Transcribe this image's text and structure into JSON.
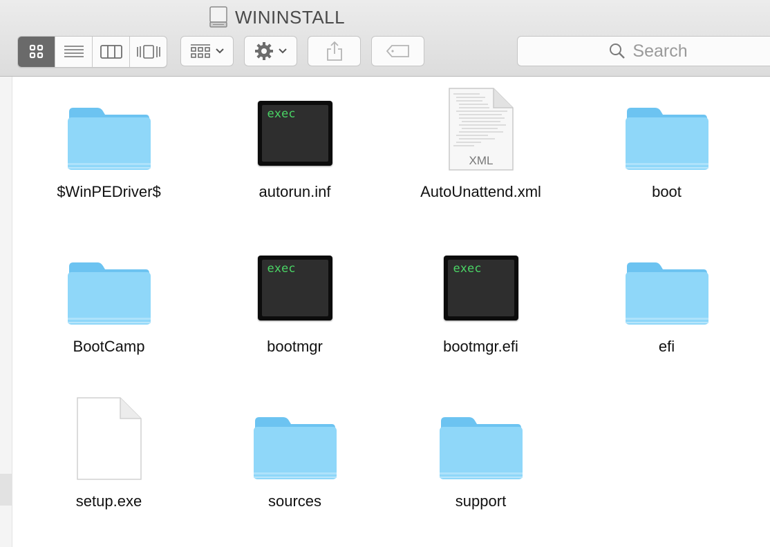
{
  "window": {
    "title": "WININSTALL"
  },
  "toolbar": {
    "view_modes": [
      {
        "name": "icon-view",
        "active": true
      },
      {
        "name": "list-view",
        "active": false
      },
      {
        "name": "column-view",
        "active": false
      },
      {
        "name": "cover-flow-view",
        "active": false
      }
    ],
    "arrange_icon": "grid-arrange-icon",
    "action_icon": "gear-icon",
    "share_icon": "share-icon",
    "tags_icon": "tag-icon",
    "search": {
      "placeholder": "Search"
    }
  },
  "files": [
    {
      "name": "$WinPEDriver$",
      "kind": "folder"
    },
    {
      "name": "autorun.inf",
      "kind": "exec",
      "badge": "exec"
    },
    {
      "name": "AutoUnattend.xml",
      "kind": "xml",
      "badge": "XML"
    },
    {
      "name": "boot",
      "kind": "folder"
    },
    {
      "name": "BootCamp",
      "kind": "folder"
    },
    {
      "name": "bootmgr",
      "kind": "exec",
      "badge": "exec"
    },
    {
      "name": "bootmgr.efi",
      "kind": "exec",
      "badge": "exec"
    },
    {
      "name": "efi",
      "kind": "folder"
    },
    {
      "name": "setup.exe",
      "kind": "document"
    },
    {
      "name": "sources",
      "kind": "folder"
    },
    {
      "name": "support",
      "kind": "folder"
    }
  ],
  "colors": {
    "folder_front": "#8fd7f9",
    "folder_back": "#6cc3f1",
    "terminal_text": "#4ad465",
    "active_view": "#6a6a6a"
  }
}
